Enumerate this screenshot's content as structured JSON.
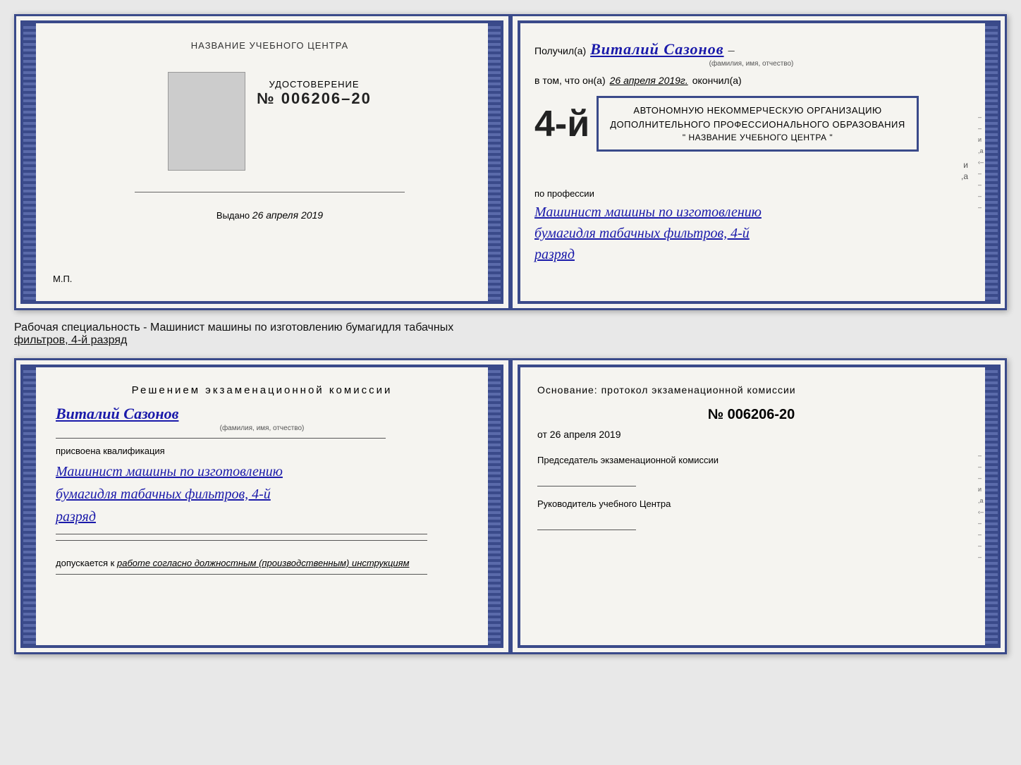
{
  "top_cert": {
    "left": {
      "title_label": "НАЗВАНИЕ УЧЕБНОГО ЦЕНТРА",
      "udostoverenie": "УДОСТОВЕРЕНИЕ",
      "number": "№ 006206–20",
      "issued_label": "Выдано",
      "issued_date": "26 апреля 2019",
      "mp_label": "М.П."
    },
    "right": {
      "poluchil_label": "Получил(а)",
      "recipient_name": "Виталий Сазонов",
      "recipient_subtitle": "(фамилия, имя, отчество)",
      "dash": "–",
      "vtom_label": "в том, что он(а)",
      "vtom_date": "26 апреля 2019г.",
      "okoncil_label": "окончил(а)",
      "razryad_big": "4-й",
      "org_line1": "АВТОНОМНУЮ НЕКОММЕРЧЕСКУЮ ОРГАНИЗАЦИЮ",
      "org_line2": "ДОПОЛНИТЕЛЬНОГО ПРОФЕССИОНАЛЬНОГО ОБРАЗОВАНИЯ",
      "org_line3": "\" НАЗВАНИЕ УЧЕБНОГО ЦЕНТРА \"",
      "profession_label": "по профессии",
      "profession_line1": "Машинист машины по изготовлению",
      "profession_line2": "бумагидля табачных фильтров, 4-й",
      "profession_line3": "разряд"
    }
  },
  "middle_text": {
    "line1": "Рабочая специальность - Машинист машины по изготовлению бумагидля табачных",
    "line2": "фильтров, 4-й разряд"
  },
  "bottom_cert": {
    "left": {
      "decision_title": "Решением  экзаменационной  комиссии",
      "name": "Виталий Сазонов",
      "fio_subtitle": "(фамилия, имя, отчество)",
      "prisvoena_label": "присвоена квалификация",
      "profession_line1": "Машинист машины по изготовлению",
      "profession_line2": "бумагидля табачных фильтров, 4-й",
      "profession_line3": "разряд",
      "dopuskaetsya_label": "допускается к",
      "dopuskaetsya_text": "работе согласно должностным (производственным) инструкциям"
    },
    "right": {
      "osnovaniye_label": "Основание: протокол экзаменационной  комиссии",
      "protocol_number": "№  006206-20",
      "protocol_date_label": "от",
      "protocol_date": "26 апреля 2019",
      "predsedatel_label": "Председатель экзаменационной комиссии",
      "rukovoditel_label": "Руководитель учебного Центра"
    }
  }
}
